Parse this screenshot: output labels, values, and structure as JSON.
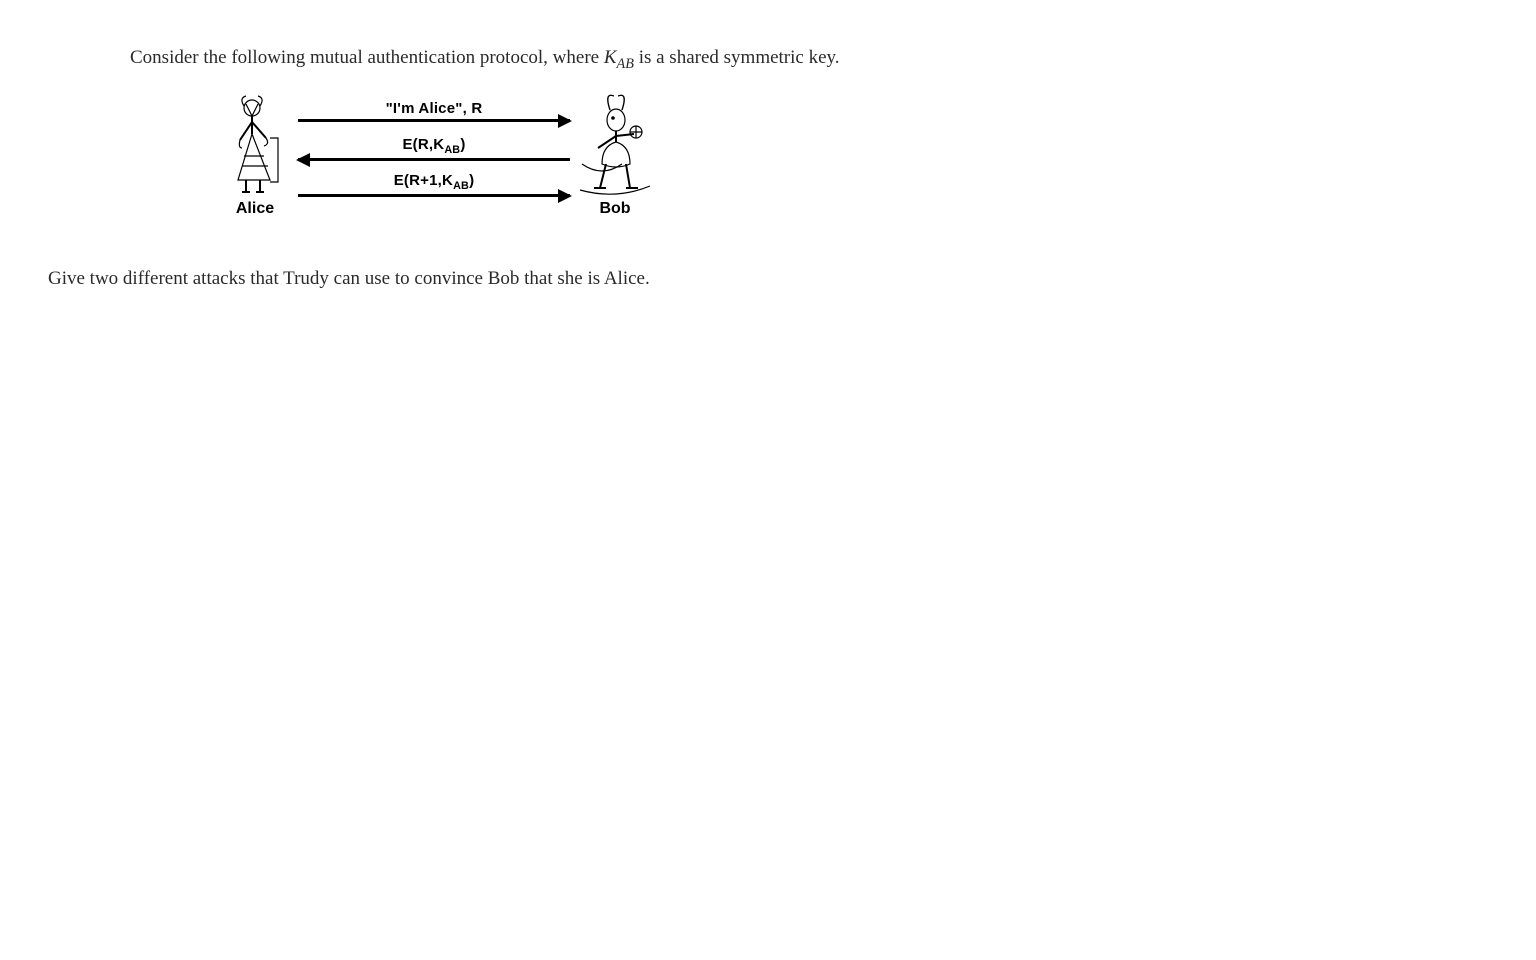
{
  "intro": {
    "part1": "Consider the following mutual authentication protocol, where ",
    "key": "K",
    "keysub": "AB",
    "part2": " is a shared symmetric key."
  },
  "diagram": {
    "alice": "Alice",
    "bob": "Bob",
    "msg1": "\"I'm Alice\", R",
    "msg2_pre": "E(R,K",
    "msg2_sub": "AB",
    "msg2_post": ")",
    "msg3_pre": "E(R+1,K",
    "msg3_sub": "AB",
    "msg3_post": ")"
  },
  "question": "Give two different attacks that Trudy can use to convince Bob that she is Alice."
}
